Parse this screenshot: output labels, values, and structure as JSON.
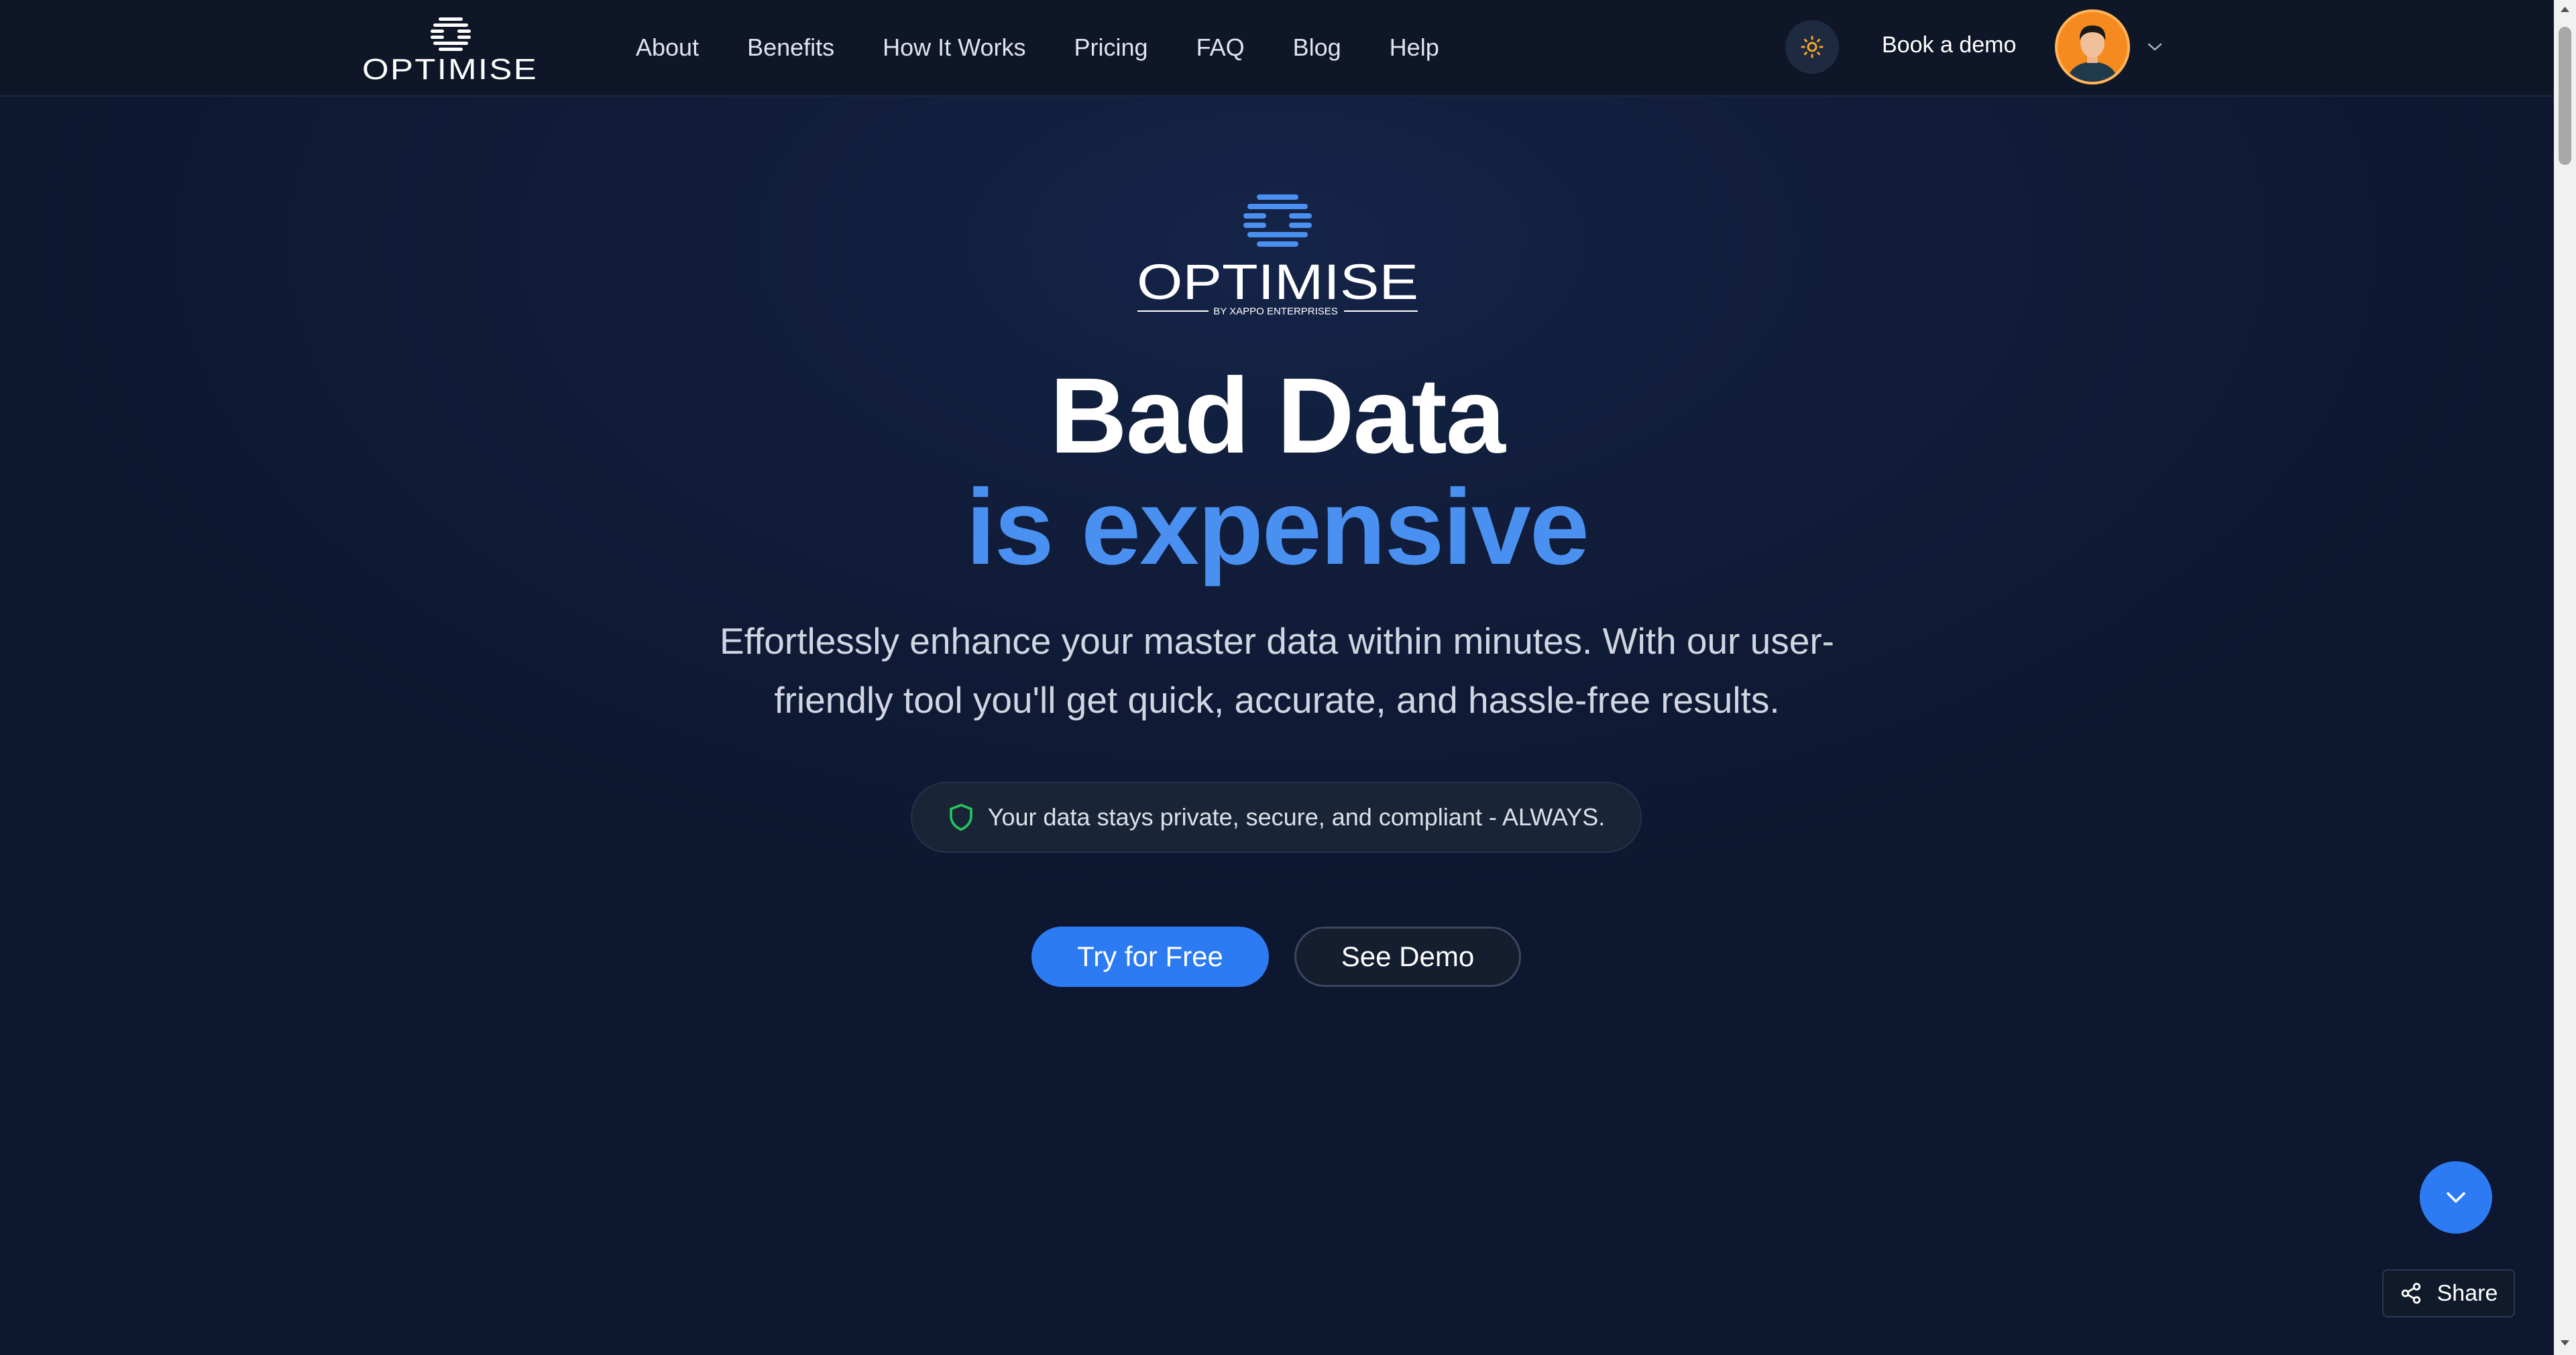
{
  "header": {
    "logo_text": "OPTIMISE",
    "nav": [
      {
        "label": "About"
      },
      {
        "label": "Benefits"
      },
      {
        "label": "How It Works"
      },
      {
        "label": "Pricing"
      },
      {
        "label": "FAQ"
      },
      {
        "label": "Blog"
      },
      {
        "label": "Help"
      }
    ],
    "theme_toggle_icon": "sun-icon",
    "book_demo_label": "Book a demo",
    "avatar_icon": "user-avatar",
    "menu_icon": "chevron-down-icon"
  },
  "hero": {
    "logo_text": "OPTIMISE",
    "logo_tagline": "BY XAPPO ENTERPRISES",
    "headline_line1": "Bad Data",
    "headline_line2": "is expensive",
    "subtitle": "Effortlessly enhance your master data within minutes. With our user-friendly tool you'll get quick, accurate, and hassle-free results.",
    "privacy_text": "Your data stays private, secure, and compliant - ALWAYS.",
    "primary_cta": "Try for Free",
    "secondary_cta": "See Demo"
  },
  "floating": {
    "scroll_icon": "chevron-down-icon",
    "share_label": "Share",
    "share_icon": "share-icon"
  },
  "colors": {
    "accent": "#2c7bf2",
    "headline_accent": "#4a90f0",
    "background": "#101a33",
    "shield": "#22c55e",
    "sun": "#f5a623",
    "avatar_bg": "#f58a1f"
  }
}
